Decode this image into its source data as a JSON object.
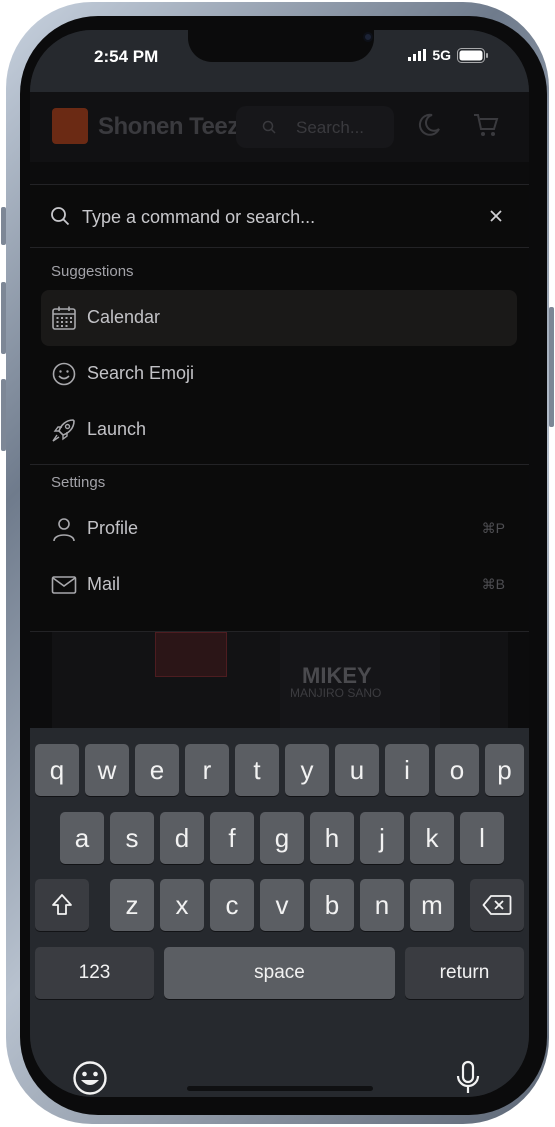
{
  "status_bar": {
    "time": "2:54 PM",
    "network": "5G"
  },
  "site": {
    "name": "Shonen Teez",
    "search_placeholder": "Search..."
  },
  "background_art": {
    "title": "MIKEY",
    "subtitle": "MANJIRO SANO"
  },
  "command_palette": {
    "placeholder": "Type a command or search...",
    "groups": [
      {
        "heading": "Suggestions",
        "items": [
          {
            "label": "Calendar",
            "icon": "calendar-icon",
            "selected": true
          },
          {
            "label": "Search Emoji",
            "icon": "smile-icon",
            "selected": false
          },
          {
            "label": "Launch",
            "icon": "rocket-icon",
            "selected": false
          }
        ]
      },
      {
        "heading": "Settings",
        "items": [
          {
            "label": "Profile",
            "icon": "user-icon",
            "shortcut": "⌘P"
          },
          {
            "label": "Mail",
            "icon": "mail-icon",
            "shortcut": "⌘B"
          }
        ]
      }
    ]
  },
  "keyboard": {
    "row1": [
      "q",
      "w",
      "e",
      "r",
      "t",
      "y",
      "u",
      "i",
      "o",
      "p"
    ],
    "row2": [
      "a",
      "s",
      "d",
      "f",
      "g",
      "h",
      "j",
      "k",
      "l"
    ],
    "row3": [
      "z",
      "x",
      "c",
      "v",
      "b",
      "n",
      "m"
    ],
    "numbers_label": "123",
    "space_label": "space",
    "return_label": "return"
  },
  "colors": {
    "keyboard_bg": "#26292e",
    "key": "#5b5e63",
    "panel_bg": "#0b0b0b",
    "selected_item": "#1a1918"
  }
}
